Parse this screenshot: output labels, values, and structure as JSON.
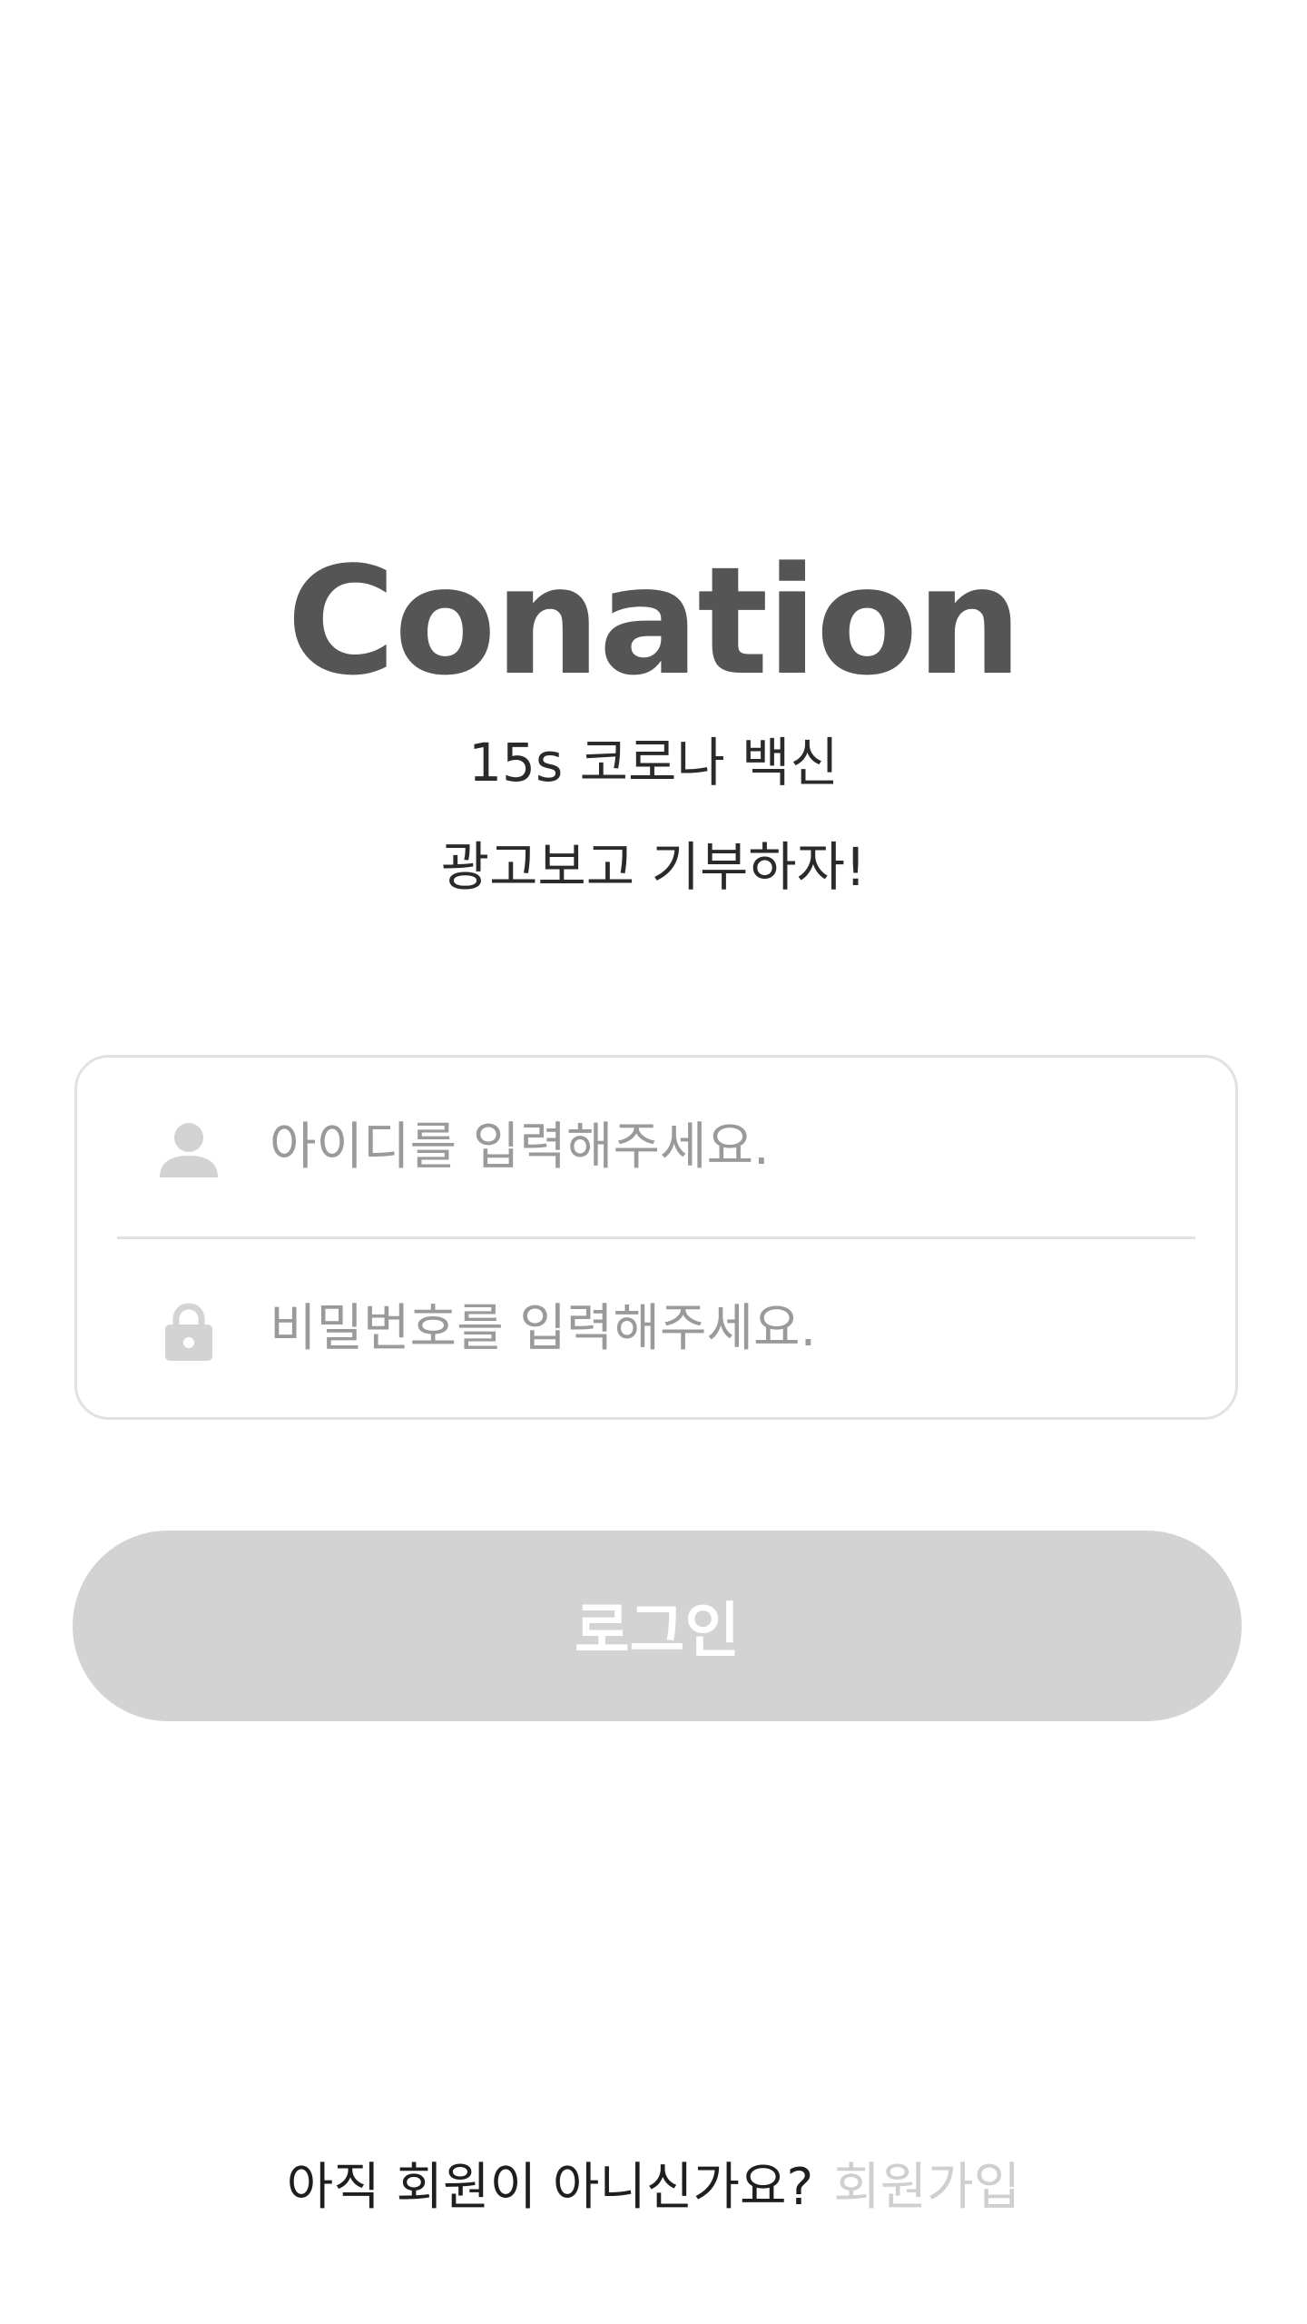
{
  "app": {
    "title": "Conation",
    "tagline_line1": "15s 코로나 백신",
    "tagline_line2": "광고보고 기부하자!"
  },
  "login_form": {
    "id_field": {
      "icon": "person-icon",
      "placeholder": "아이디를 입력해주세요.",
      "value": ""
    },
    "password_field": {
      "icon": "lock-icon",
      "placeholder": "비밀번호를 입력해주세요.",
      "value": ""
    },
    "login_button_label": "로그인"
  },
  "signup": {
    "question": "아직 회원이 아니신가요?",
    "link_label": "회원가입"
  },
  "colors": {
    "title": "#555555",
    "border": "#e2e2e2",
    "button_disabled": "#d3d3d3",
    "placeholder": "#9a9a9a",
    "signup_link": "#cfcfcf"
  }
}
